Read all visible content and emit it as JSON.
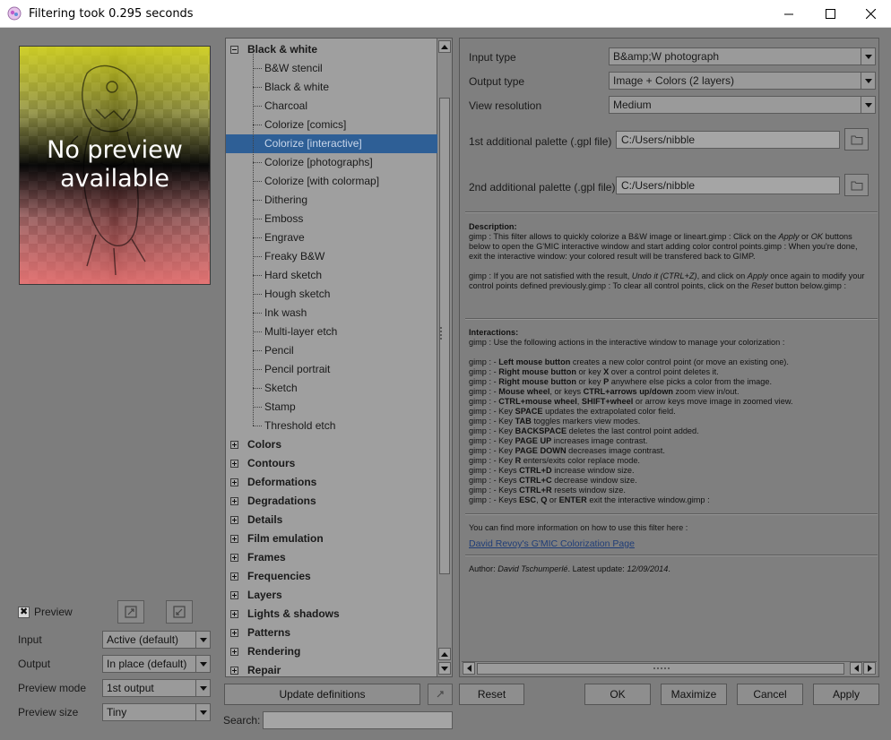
{
  "window": {
    "title": "Filtering took 0.295 seconds",
    "controls": [
      "minimize",
      "maximize",
      "close"
    ]
  },
  "preview": {
    "placeholder_line1": "No preview",
    "placeholder_line2": "available",
    "checkbox_label": "Preview",
    "checked": true
  },
  "left_form": {
    "input_label": "Input",
    "input_value": "Active (default)",
    "output_label": "Output",
    "output_value": "In place (default)",
    "preview_mode_label": "Preview mode",
    "preview_mode_value": "1st output",
    "preview_size_label": "Preview size",
    "preview_size_value": "Tiny"
  },
  "tree": {
    "expanded_category": "Black & white",
    "expanded_items": [
      "B&W stencil",
      "Black & white",
      "Charcoal",
      "Colorize [comics]",
      "Colorize [interactive]",
      "Colorize [photographs]",
      "Colorize [with colormap]",
      "Dithering",
      "Emboss",
      "Engrave",
      "Freaky B&W",
      "Hard sketch",
      "Hough sketch",
      "Ink wash",
      "Multi-layer etch",
      "Pencil",
      "Pencil portrait",
      "Sketch",
      "Stamp",
      "Threshold etch"
    ],
    "selected_item": "Colorize [interactive]",
    "collapsed_categories": [
      "Colors",
      "Contours",
      "Deformations",
      "Degradations",
      "Details",
      "Film emulation",
      "Frames",
      "Frequencies",
      "Layers",
      "Lights & shadows",
      "Patterns",
      "Rendering",
      "Repair"
    ]
  },
  "tree_footer": {
    "update_button": "Update definitions",
    "search_label": "Search:",
    "search_value": ""
  },
  "params": {
    "input_type_label": "Input type",
    "input_type_value": "B&amp;W photograph",
    "output_type_label": "Output type",
    "output_type_value": "Image + Colors (2 layers)",
    "view_res_label": "View resolution",
    "view_res_value": "Medium",
    "palette1_label": "1st additional palette (.gpl file)",
    "palette1_value": "C:/Users/nibble",
    "palette2_label": "2nd additional palette (.gpl file)",
    "palette2_value": "C:/Users/nibble",
    "description_heading": "Description:",
    "description_lines": [
      "gimp : This filter allows to quickly colorize a B&W image or lineart.gimp : Click on the ",
      "Apply",
      " or ",
      "OK",
      " buttons below to open the G'MIC interactive window and start adding color control points.gimp : When you're done, exit the interactive window: your colored result will be transfered back to GIMP.",
      "gimp : If you are not satisfied with the result, ",
      "Undo it (CTRL+Z)",
      ", and click on ",
      "Apply",
      " once again to modify your control points defined previously.gimp : To clear all control points, click on the ",
      "Reset",
      " button below.gimp :"
    ],
    "interactions_heading": "Interactions:",
    "interactions_intro": "gimp : Use the following actions in the interactive window to manage your colorization :",
    "interactions": [
      {
        "pre": "gimp : - ",
        "bold": "Left mouse button",
        "post": " creates a new color control point (or move an existing one)."
      },
      {
        "pre": "gimp : - ",
        "bold": "Right mouse button",
        "post": " or key ",
        "bold2": "X",
        "post2": " over a control point deletes it."
      },
      {
        "pre": "gimp : - ",
        "bold": "Right mouse button",
        "post": " or key ",
        "bold2": "P",
        "post2": " anywhere else picks a color from the image."
      },
      {
        "pre": "gimp : - ",
        "bold": "Mouse wheel",
        "post": ", or keys ",
        "bold2": "CTRL+arrows up/down",
        "post2": " zoom view in/out."
      },
      {
        "pre": "gimp : - ",
        "bold": "CTRL+mouse wheel",
        "post": ", ",
        "bold2": "SHIFT+wheel",
        "post2": " or arrow keys move image in zoomed view."
      },
      {
        "pre": "gimp : - Key ",
        "bold": "SPACE",
        "post": " updates the extrapolated color field."
      },
      {
        "pre": "gimp : - Key ",
        "bold": "TAB",
        "post": " toggles markers view modes."
      },
      {
        "pre": "gimp : - Key ",
        "bold": "BACKSPACE",
        "post": " deletes the last control point added."
      },
      {
        "pre": "gimp : - Key ",
        "bold": "PAGE UP",
        "post": " increases image contrast."
      },
      {
        "pre": "gimp : - Key ",
        "bold": "PAGE DOWN",
        "post": " decreases image contrast."
      },
      {
        "pre": "gimp : - Key ",
        "bold": "R",
        "post": " enters/exits color replace mode."
      },
      {
        "pre": "gimp : - Keys ",
        "bold": "CTRL+D",
        "post": " increase window size."
      },
      {
        "pre": "gimp : - Keys ",
        "bold": "CTRL+C",
        "post": " decrease window size."
      },
      {
        "pre": "gimp : - Keys ",
        "bold": "CTRL+R",
        "post": " resets window size."
      },
      {
        "pre": "gimp : - Keys ",
        "bold": "ESC",
        "post": ", ",
        "bold2": "Q",
        "post2": " or ",
        "bold3": "ENTER",
        "post3": " exit the interactive window.gimp :"
      }
    ],
    "more_info": "You can find more information on how to use this filter here :",
    "link_text": "David Revoy's G'MIC Colorization Page",
    "author_prefix": "Author: ",
    "author": "David Tschumperlé",
    "update_prefix": ". Latest update: ",
    "update_date": "12/09/2014",
    "update_suffix": "."
  },
  "bottom_buttons": {
    "reset": "Reset",
    "ok": "OK",
    "maximize": "Maximize",
    "cancel": "Cancel",
    "apply": "Apply"
  },
  "colors": {
    "selection": "#2e5f96",
    "link": "#1f3d77",
    "panel_bg": "#7d7d7d"
  }
}
